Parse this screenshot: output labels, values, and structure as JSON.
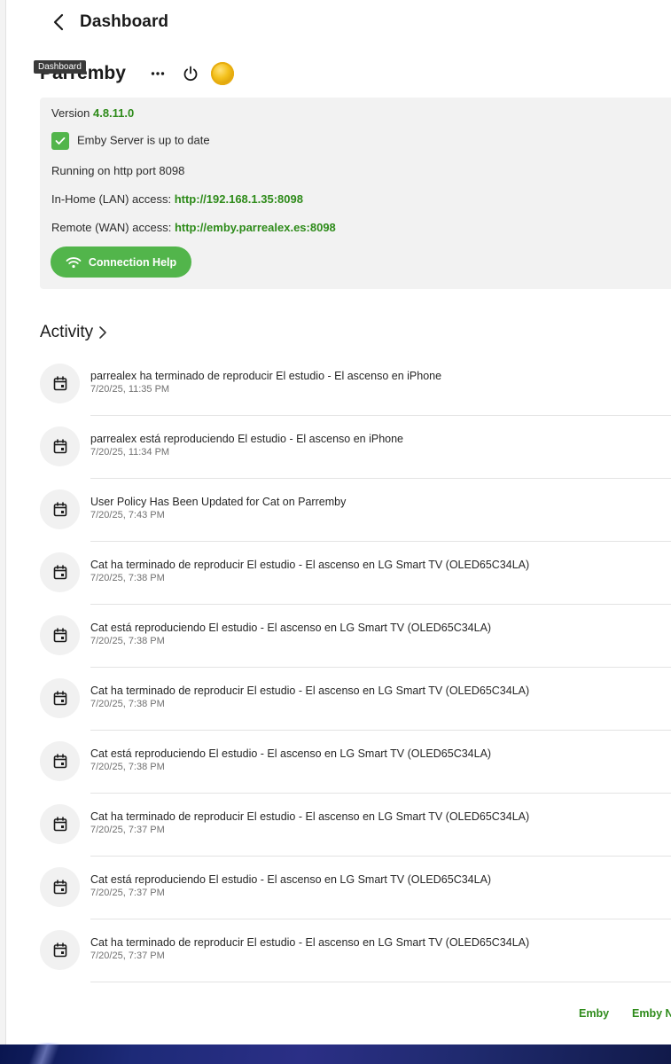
{
  "header": {
    "back_label": "Back",
    "title": "Dashboard"
  },
  "tooltip": {
    "text": "Dashboard"
  },
  "server": {
    "name": "Parremby"
  },
  "server_info": {
    "version_label": "Version ",
    "version_value": "4.8.11.0",
    "update_status": "Emby Server is up to date",
    "port_text": "Running on http port 8098",
    "lan_label": "In-Home (LAN) access: ",
    "lan_url": "http://192.168.1.35:8098",
    "wan_label": "Remote (WAN) access: ",
    "wan_url": "http://emby.parrealex.es:8098",
    "connection_help_label": "Connection Help"
  },
  "activity": {
    "title": "Activity",
    "items": [
      {
        "text": "parrealex ha terminado de reproducir El estudio - El ascenso en iPhone",
        "date": "7/20/25, 11:35 PM"
      },
      {
        "text": "parrealex está reproduciendo El estudio - El ascenso en iPhone",
        "date": "7/20/25, 11:34 PM"
      },
      {
        "text": "User Policy Has Been Updated for Cat on Parremby",
        "date": "7/20/25, 7:43 PM"
      },
      {
        "text": "Cat ha terminado de reproducir El estudio - El ascenso en LG Smart TV (OLED65C34LA)",
        "date": "7/20/25, 7:38 PM"
      },
      {
        "text": "Cat está reproduciendo El estudio - El ascenso en LG Smart TV (OLED65C34LA)",
        "date": "7/20/25, 7:38 PM"
      },
      {
        "text": "Cat ha terminado de reproducir El estudio - El ascenso en LG Smart TV (OLED65C34LA)",
        "date": "7/20/25, 7:38 PM"
      },
      {
        "text": "Cat está reproduciendo El estudio - El ascenso en LG Smart TV (OLED65C34LA)",
        "date": "7/20/25, 7:38 PM"
      },
      {
        "text": "Cat ha terminado de reproducir El estudio - El ascenso en LG Smart TV (OLED65C34LA)",
        "date": "7/20/25, 7:37 PM"
      },
      {
        "text": "Cat está reproduciendo El estudio - El ascenso en LG Smart TV (OLED65C34LA)",
        "date": "7/20/25, 7:37 PM"
      },
      {
        "text": "Cat ha terminado de reproducir El estudio - El ascenso en LG Smart TV (OLED65C34LA)",
        "date": "7/20/25, 7:37 PM"
      }
    ]
  },
  "footer": {
    "links": [
      "Emby",
      "Emby N"
    ]
  },
  "colors": {
    "accent": "#52b54b",
    "link": "#2e8b1a"
  },
  "icons": {
    "back": "chevron-left-icon",
    "more": "more-horizontal-icon",
    "power": "power-icon",
    "premiere": "emby-premiere-badge-icon",
    "check": "check-icon",
    "wifi": "wifi-icon",
    "activity_item": "calendar-icon"
  }
}
